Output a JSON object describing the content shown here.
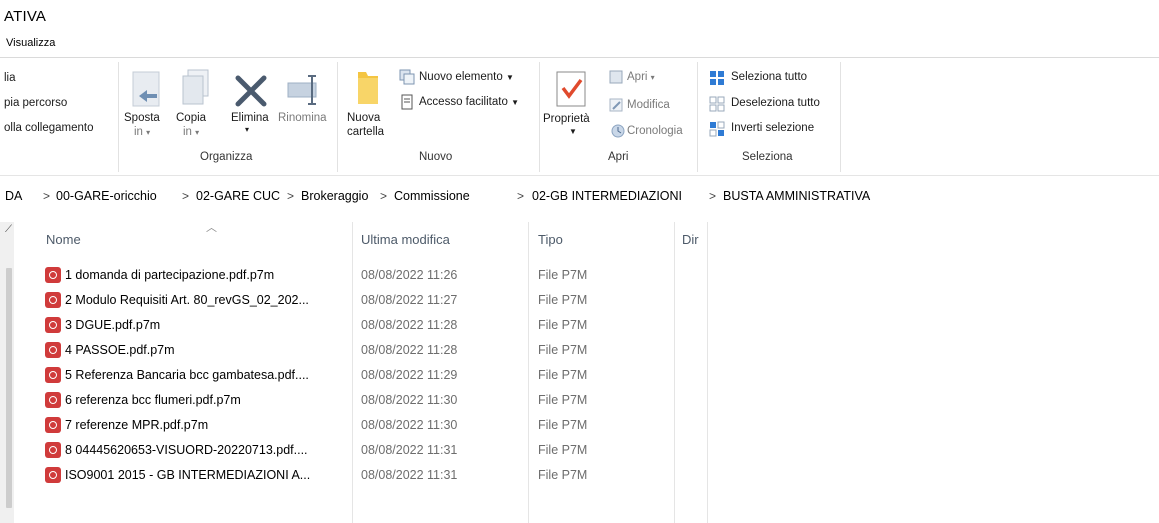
{
  "window": {
    "title": "ATIVA"
  },
  "menu": {
    "visualizza": "Visualizza"
  },
  "ribbon": {
    "clipboard": {
      "item1": "lia",
      "item2": "pia percorso",
      "item3": "olla collegamento"
    },
    "organizza": {
      "group_label": "Organizza",
      "sposta_label": "Sposta",
      "sposta_sub": "in",
      "copia_label": "Copia",
      "copia_sub": "in",
      "elimina_label": "Elimina",
      "rinomina_label": "Rinomina"
    },
    "nuovo": {
      "group_label": "Nuovo",
      "nuova_cartella_line1": "Nuova",
      "nuova_cartella_line2": "cartella",
      "nuovo_elemento": "Nuovo elemento",
      "accesso_facilitato": "Accesso facilitato"
    },
    "apri": {
      "group_label": "Apri",
      "proprieta": "Proprietà",
      "apri": "Apri",
      "modifica": "Modifica",
      "cronologia": "Cronologia"
    },
    "seleziona": {
      "group_label": "Seleziona",
      "seleziona_tutto": "Seleziona tutto",
      "deseleziona_tutto": "Deseleziona tutto",
      "inverti_selezione": "Inverti selezione"
    }
  },
  "address": {
    "crumbs": [
      "DA",
      "00-GARE-oricchio",
      "02-GARE CUC",
      "Brokeraggio",
      "Commissione",
      "02-GB INTERMEDIAZIONI",
      "BUSTA AMMINISTRATIVA"
    ],
    "separator": ">"
  },
  "columns": {
    "name": "Nome",
    "modified": "Ultima modifica",
    "type": "Tipo",
    "size": "Dir"
  },
  "files": [
    {
      "name": "1 domanda di partecipazione.pdf.p7m",
      "modified": "08/08/2022 11:26",
      "type": "File P7M"
    },
    {
      "name": "2 Modulo Requisiti Art. 80_revGS_02_202...",
      "modified": "08/08/2022 11:27",
      "type": "File P7M"
    },
    {
      "name": "3 DGUE.pdf.p7m",
      "modified": "08/08/2022 11:28",
      "type": "File P7M"
    },
    {
      "name": "4 PASSOE.pdf.p7m",
      "modified": "08/08/2022 11:28",
      "type": "File P7M"
    },
    {
      "name": "5 Referenza Bancaria bcc gambatesa.pdf....",
      "modified": "08/08/2022 11:29",
      "type": "File P7M"
    },
    {
      "name": "6 referenza bcc flumeri.pdf.p7m",
      "modified": "08/08/2022 11:30",
      "type": "File P7M"
    },
    {
      "name": "7 referenze MPR.pdf.p7m",
      "modified": "08/08/2022 11:30",
      "type": "File P7M"
    },
    {
      "name": "8 04445620653-VISUORD-20220713.pdf....",
      "modified": "08/08/2022 11:31",
      "type": "File P7M"
    },
    {
      "name": "ISO9001 2015 - GB INTERMEDIAZIONI A...",
      "modified": "08/08/2022 11:31",
      "type": "File P7M"
    }
  ]
}
